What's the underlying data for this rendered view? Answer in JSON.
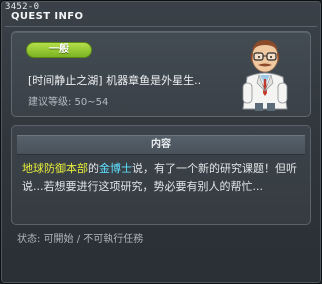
{
  "window": {
    "quest_id": "3452-0",
    "title": "QUEST INFO"
  },
  "summary": {
    "category": "一般",
    "quest_name": "[时间静止之湖] 机器章鱼是外星生..",
    "required_level": "建议等级: 50~54"
  },
  "details": {
    "section_title": "内容",
    "description": {
      "org": "地球防御本部",
      "mid1": "的",
      "npc": "金博士",
      "rest": "说，有了一个新的研究课题！但听说...若想要进行这项研究，势必要有别人的帮忙..."
    }
  },
  "status": {
    "text": "状态: 可開始 / 不可執行任務"
  },
  "colors": {
    "badge_green": "#8cc63f",
    "org_highlight": "#e8ef3a",
    "npc_highlight": "#5ee0ff"
  },
  "icons": {
    "npc_portrait": "doctor-npc-icon"
  }
}
